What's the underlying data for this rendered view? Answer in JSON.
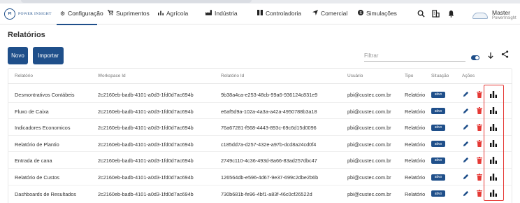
{
  "brand": {
    "logo_text": "POWER INSIGHT"
  },
  "nav": {
    "items": [
      {
        "label": "Configuração",
        "icon": "gear-icon",
        "glyph": "⚙"
      },
      {
        "label": "Suprimentos",
        "icon": "cart-icon",
        "glyph": "🛒"
      },
      {
        "label": "Agrícola",
        "icon": "bar-chart-icon",
        "glyph": "▖"
      },
      {
        "label": "Indústria",
        "icon": "factory-icon",
        "glyph": "▟"
      },
      {
        "label": "Controladoria",
        "icon": "columns-icon",
        "glyph": "▮"
      },
      {
        "label": "Comercial",
        "icon": "send-icon",
        "glyph": "➤"
      },
      {
        "label": "Simulações",
        "icon": "dollar-icon",
        "glyph": "●"
      }
    ]
  },
  "user": {
    "name": "Master",
    "subtitle": "PowerInsight"
  },
  "page": {
    "title": "Relatórios"
  },
  "toolbar": {
    "new_label": "Novo",
    "import_label": "Importar",
    "filter_placeholder": "Filtrar"
  },
  "table": {
    "headers": {
      "report": "Relatório",
      "workspace": "Workspace Id",
      "report_id": "Relatório Id",
      "user": "Usuário",
      "type": "Tipo",
      "status": "Situação",
      "actions": "Ações"
    },
    "rows": [
      {
        "name": "Desmontrativos Contábeis",
        "workspace": "2c2160eb-badb-4101-a0d3-1fd0d7ac694b",
        "report_id": "9b38a4ca-e253-48cb-99a6-936124c831e9",
        "user": "pbi@custec.com.br",
        "type": "Relatório",
        "status": "ativo"
      },
      {
        "name": "Fluxo de Caixa",
        "workspace": "2c2160eb-badb-4101-a0d3-1fd0d7ac694b",
        "report_id": "e6af5d9a-102a-4a3a-a42a-4950788b3a18",
        "user": "pbi@custec.com.br",
        "type": "Relatório",
        "status": "ativo"
      },
      {
        "name": "Indicadores Economicos",
        "workspace": "2c2160eb-badb-4101-a0d3-1fd0d7ac694b",
        "report_id": "76a67281-f568-4443-893c-69c6d15d0096",
        "user": "pbi@custec.com.br",
        "type": "Relatório",
        "status": "ativo"
      },
      {
        "name": "Relatório de Plantio",
        "workspace": "2c2160eb-badb-4101-a0d3-1fd0d7ac694b",
        "report_id": "c185dd7a-d257-432e-a97b-dcd8a24cd0f4",
        "user": "pbi@custec.com.br",
        "type": "Relatório",
        "status": "ativo"
      },
      {
        "name": "Entrada de cana",
        "workspace": "2c2160eb-badb-4101-a0d3-1fd0d7ac694b",
        "report_id": "2749c110-4c36-493d-8a66-83ad257dbc47",
        "user": "pbi@custec.com.br",
        "type": "Relatório",
        "status": "ativo"
      },
      {
        "name": "Relatório de Custos",
        "workspace": "2c2160eb-badb-4101-a0d3-1fd0d7ac694b",
        "report_id": "126564db-e596-4d67-9e37-699c2dbe2b6b",
        "user": "pbi@custec.com.br",
        "type": "Relatório",
        "status": "ativo"
      },
      {
        "name": "Dashboards de Resultados",
        "workspace": "2c2160eb-badb-4101-a0d3-1fd0d7ac694b",
        "report_id": "730b681b-fe96-4bf1-a83f-46c0cf26522d",
        "user": "pbi@custec.com.br",
        "type": "Relatório",
        "status": "ativo"
      }
    ]
  },
  "colors": {
    "primary": "#1f4f8a",
    "danger": "#e53935",
    "highlight": "#e53935"
  }
}
